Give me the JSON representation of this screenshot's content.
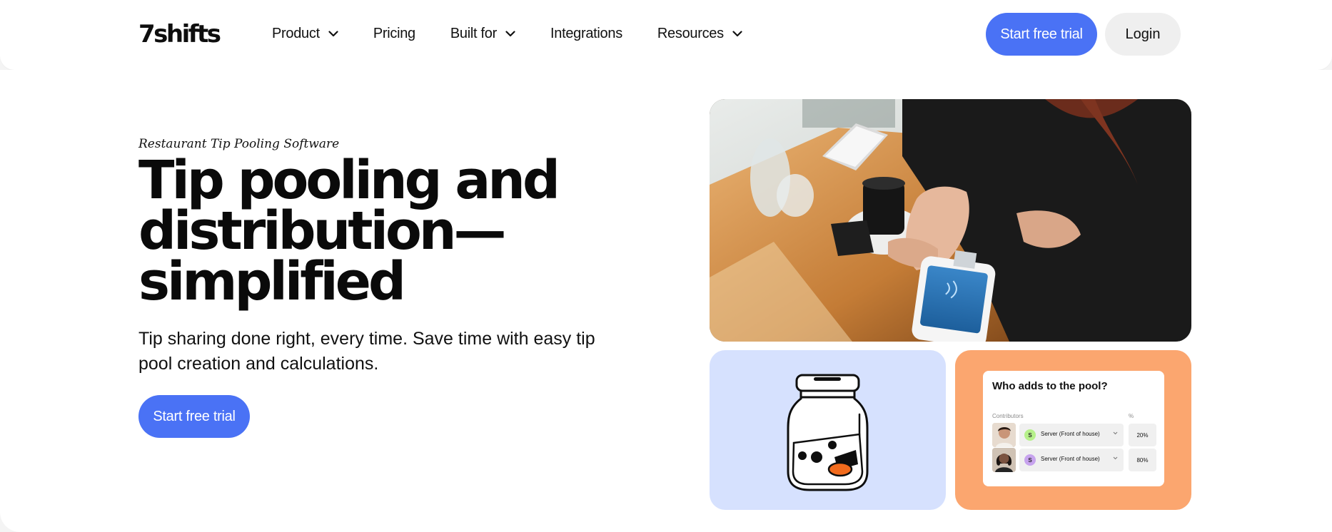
{
  "header": {
    "logo": "7shifts",
    "nav": [
      {
        "label": "Product",
        "has_dropdown": true
      },
      {
        "label": "Pricing",
        "has_dropdown": false
      },
      {
        "label": "Built for",
        "has_dropdown": true
      },
      {
        "label": "Integrations",
        "has_dropdown": false
      },
      {
        "label": "Resources",
        "has_dropdown": true
      }
    ],
    "cta_label": "Start free trial",
    "login_label": "Login"
  },
  "hero": {
    "eyebrow": "Restaurant Tip Pooling Software",
    "title_lines": [
      "Tip pooling and",
      "distribution—",
      "simplified"
    ],
    "subtitle": "Tip sharing done right, every time. Save time with easy tip pool creation and calculations.",
    "cta_label": "Start free trial"
  },
  "pool_card": {
    "question": "Who adds to the pool?",
    "contributors_label": "Contributors",
    "percent_label": "%",
    "rows": [
      {
        "role": "Server (Front of house)",
        "badge": "S",
        "badge_color": "#b6f08a",
        "percent": "20%"
      },
      {
        "role": "Server (Front of house)",
        "badge": "S",
        "badge_color": "#c7a3ee",
        "percent": "80%"
      }
    ]
  },
  "colors": {
    "accent": "#4a72f5",
    "jar_card_bg": "#d6e1fe",
    "pool_card_bg": "#fba66f",
    "coin": "#f26b1d"
  },
  "icons": [
    "chevron-down-icon",
    "tip-jar-icon"
  ]
}
